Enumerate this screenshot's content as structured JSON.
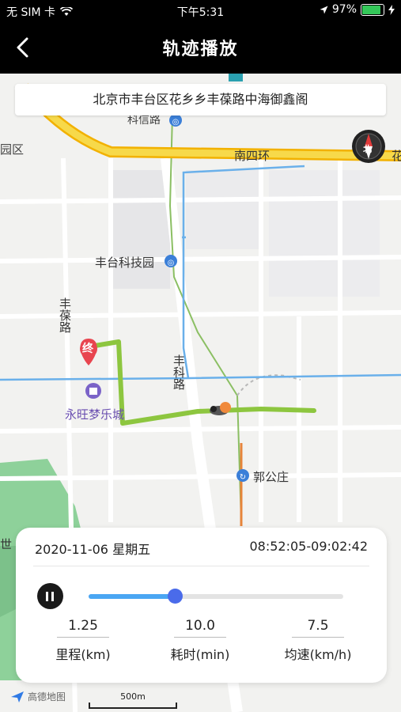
{
  "status": {
    "carrier": "无 SIM 卡",
    "time": "下午5:31",
    "battery": "97%",
    "battery_level": 0.97
  },
  "nav": {
    "title": "轨迹播放"
  },
  "address": "北京市丰台区花乡乡丰葆路中海御鑫阁",
  "compass_label": "北",
  "map_labels": {
    "district": "园区",
    "kejiroad": "科信路",
    "nansihuan": "南四环",
    "hua": "花",
    "fengtai_tech": "丰台科技园",
    "fengbaolu": "丰葆路",
    "fengkelu": "丰科路",
    "yongwang": "永旺梦乐城",
    "guogongzhuang": "郭公庄",
    "end_marker": "终",
    "shi": "世"
  },
  "panel": {
    "date": "2020-11-06  星期五",
    "time_range": "08:52:05-09:02:42",
    "progress": 0.34,
    "stats": [
      {
        "value": "1.25",
        "label": "里程(km)"
      },
      {
        "value": "10.0",
        "label": "耗时(min)"
      },
      {
        "value": "7.5",
        "label": "均速(km/h)"
      }
    ]
  },
  "footer": {
    "brand": "高德地图",
    "scale": "500m"
  },
  "colors": {
    "route": "#8dc63f",
    "ring_road": "#f7c900",
    "water": "#6ab0ea",
    "park": "#8ed19a",
    "slider_fill": "#4aa6f3",
    "slider_thumb": "#4a6bea",
    "end_marker": "#e8454f"
  }
}
